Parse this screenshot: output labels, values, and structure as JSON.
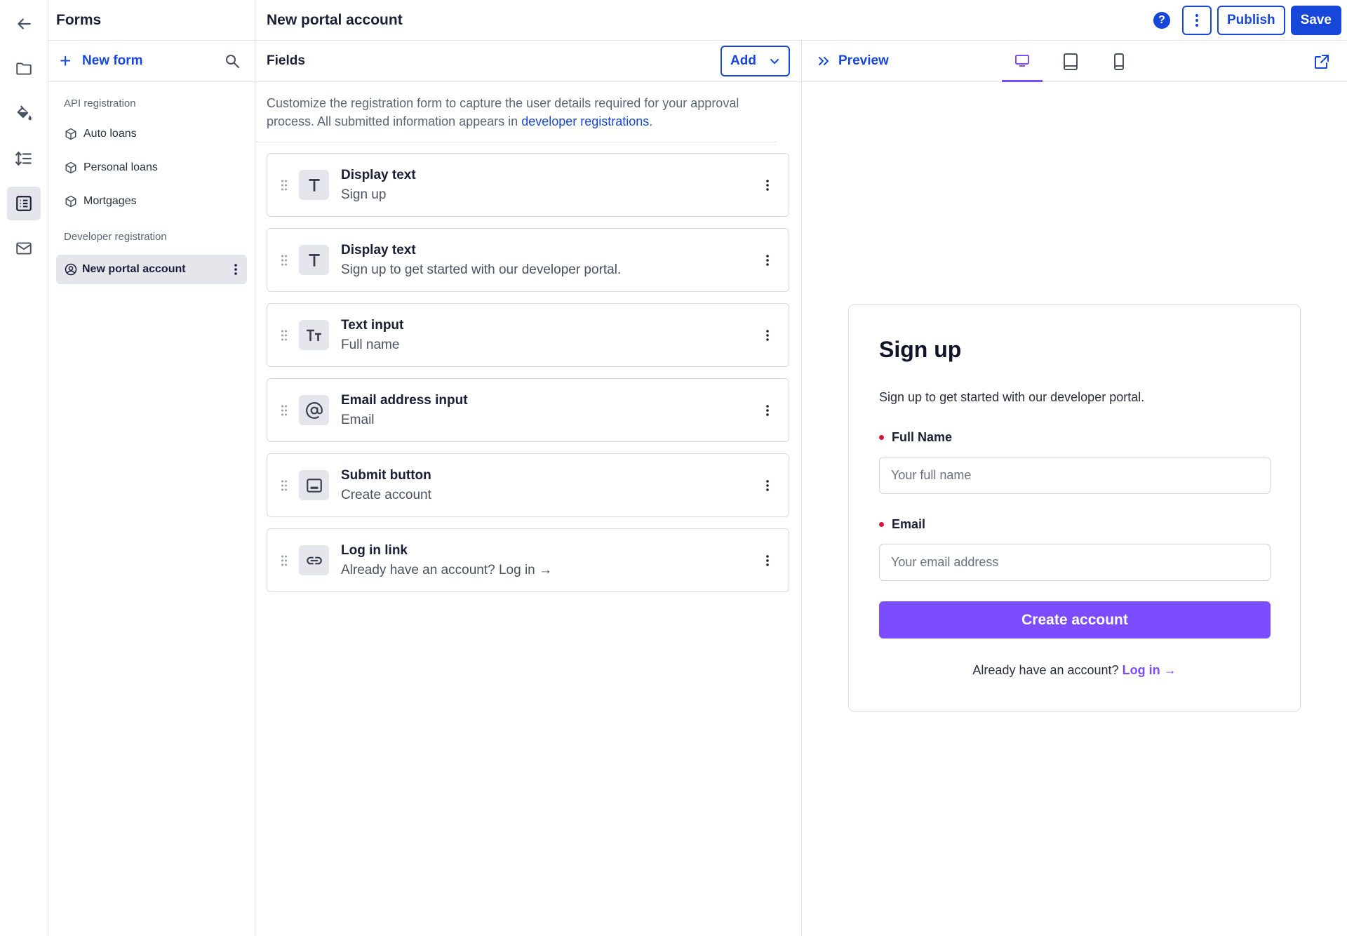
{
  "header": {
    "title": "New portal account"
  },
  "actions": {
    "publish": "Publish",
    "save": "Save",
    "help": "?"
  },
  "sidebar": {
    "title": "Forms",
    "new_form": "New form",
    "sections": [
      {
        "label": "API registration",
        "items": [
          "Auto loans",
          "Personal loans",
          "Mortgages"
        ]
      },
      {
        "label": "Developer registration",
        "items": [
          "New portal account"
        ]
      }
    ]
  },
  "fields": {
    "title": "Fields",
    "add_label": "Add",
    "description_pre": "Customize the registration form to capture the user details required for your approval process. All submitted information appears in ",
    "description_link": "developer registrations",
    "description_post": ".",
    "items": [
      {
        "type": "Display text",
        "value": "Sign up",
        "icon": "text-t-icon"
      },
      {
        "type": "Display text",
        "value": "Sign up to get started with our developer portal.",
        "icon": "text-t-icon"
      },
      {
        "type": "Text input",
        "value": "Full name",
        "icon": "text-size-icon"
      },
      {
        "type": "Email address input",
        "value": "Email",
        "icon": "at-icon"
      },
      {
        "type": "Submit button",
        "value": "Create account",
        "icon": "button-icon"
      },
      {
        "type": "Log in link",
        "value": "Already have an account? Log in →",
        "icon": "link-icon"
      }
    ]
  },
  "preview": {
    "label": "Preview",
    "devices": [
      "desktop",
      "tablet",
      "mobile"
    ],
    "active_device": "desktop",
    "form": {
      "heading": "Sign up",
      "intro": "Sign up to get started with our developer portal.",
      "name_label": "Full Name",
      "name_placeholder": "Your full name",
      "email_label": "Email",
      "email_placeholder": "Your email address",
      "submit": "Create account",
      "login_prompt": "Already have an account?",
      "login_link": "Log in →"
    }
  },
  "colors": {
    "primary": "#1647d8",
    "accent": "#7c4dff",
    "required": "#d4163c"
  }
}
